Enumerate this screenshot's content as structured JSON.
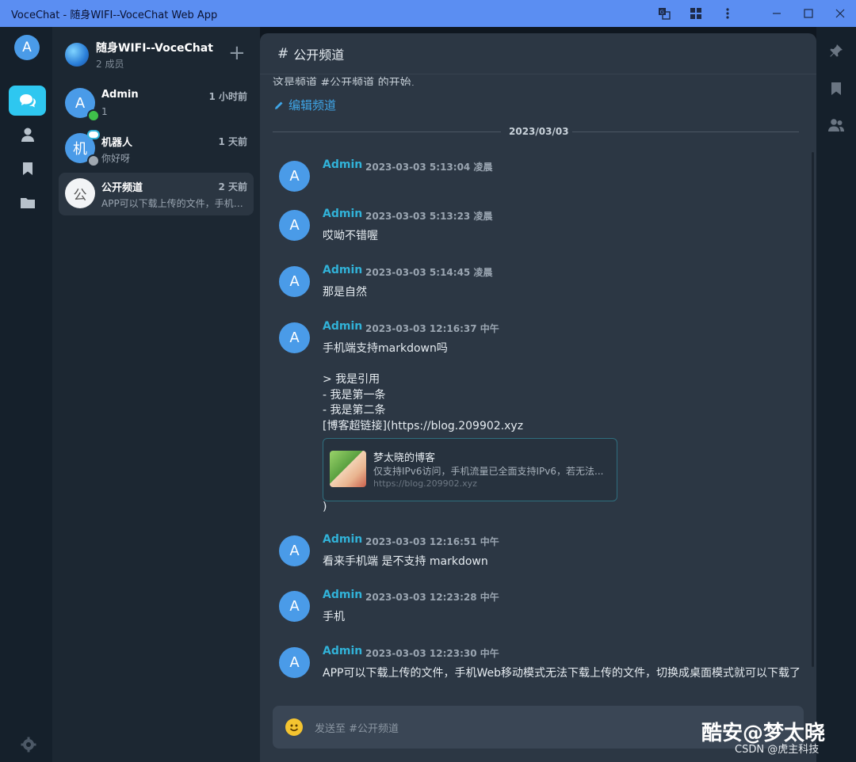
{
  "window": {
    "title": "VoceChat - 随身WIFI--VoceChat Web App"
  },
  "rail": {
    "user_initial": "A"
  },
  "server": {
    "name": "随身WIFI--VoceChat",
    "members": "2 成员"
  },
  "sessions": [
    {
      "initial": "A",
      "name": "Admin",
      "time": "1 小时前",
      "preview": "1",
      "avatar_color": "#4a9be8",
      "status_color": "#3fbf4a"
    },
    {
      "initial": "机",
      "name": "机器人",
      "time": "1 天前",
      "preview": "你好呀",
      "avatar_color": "#4a9be8",
      "status_color": "#a0a8b0"
    },
    {
      "initial": "公",
      "name": "公开频道",
      "time": "2 天前",
      "preview": "APP可以下载上传的文件，手机Web移动模式无法下载上传的文件，切换成桌面模式就可以下载了",
      "avatar_color": "#f2f4f6"
    }
  ],
  "channel": {
    "hash": "#",
    "name": "公开频道",
    "intro": "这是频道 #公开频道 的开始.",
    "edit_label": "编辑频道",
    "date_divider": "2023/03/03"
  },
  "messages": [
    {
      "avatar": "A",
      "user": "Admin",
      "time": "2023-03-03 5:13:04 凌晨",
      "lines": []
    },
    {
      "avatar": "A",
      "user": "Admin",
      "time": "2023-03-03 5:13:23 凌晨",
      "lines": [
        "哎呦不错喔"
      ]
    },
    {
      "avatar": "A",
      "user": "Admin",
      "time": "2023-03-03 5:14:45 凌晨",
      "lines": [
        "那是自然"
      ]
    },
    {
      "avatar": "A",
      "user": "Admin",
      "time": "2023-03-03 12:16:37 中午",
      "lines": [
        "手机端支持markdown吗",
        "",
        "> 我是引用",
        "- 我是第一条",
        "- 我是第二条",
        "[博客超链接](https://blog.209902.xyz"
      ]
    },
    {
      "avatar": "A",
      "user": "Admin",
      "time": "2023-03-03 12:16:51 中午",
      "lines": [
        "看来手机端 是不支持 markdown"
      ]
    },
    {
      "avatar": "A",
      "user": "Admin",
      "time": "2023-03-03 12:23:28 中午",
      "lines": [
        "手机"
      ]
    },
    {
      "avatar": "A",
      "user": "Admin",
      "time": "2023-03-03 12:23:30 中午",
      "lines": [
        "APP可以下载上传的文件，手机Web移动模式无法下载上传的文件，切换成桌面模式就可以下载了"
      ]
    }
  ],
  "link_preview": {
    "title": "梦太晓的博客",
    "description": "仅支持IPv6访问，手机流量已全面支持IPv6，若无法...",
    "url": "https://blog.209902.xyz",
    "trailing_text": ")"
  },
  "composer": {
    "placeholder": "发送至 #公开频道"
  },
  "watermark": {
    "line1": "酷安@梦太晓",
    "line2": "CSDN @虎主科技"
  },
  "colors": {
    "titlebar": "#5b8ef2",
    "accent": "#2ec7f0",
    "username": "#31b2d8",
    "online": "#3fbf4a"
  },
  "icons": {
    "titlebar": [
      "translate-icon",
      "extensions-icon",
      "more-vert-icon",
      "minimize-icon",
      "maximize-icon",
      "close-icon"
    ],
    "rail": [
      "chat-icon",
      "user-icon",
      "bookmark-icon",
      "folder-icon",
      "gear-icon"
    ],
    "right_rail": [
      "pin-icon",
      "bookmark-icon",
      "members-icon"
    ]
  }
}
